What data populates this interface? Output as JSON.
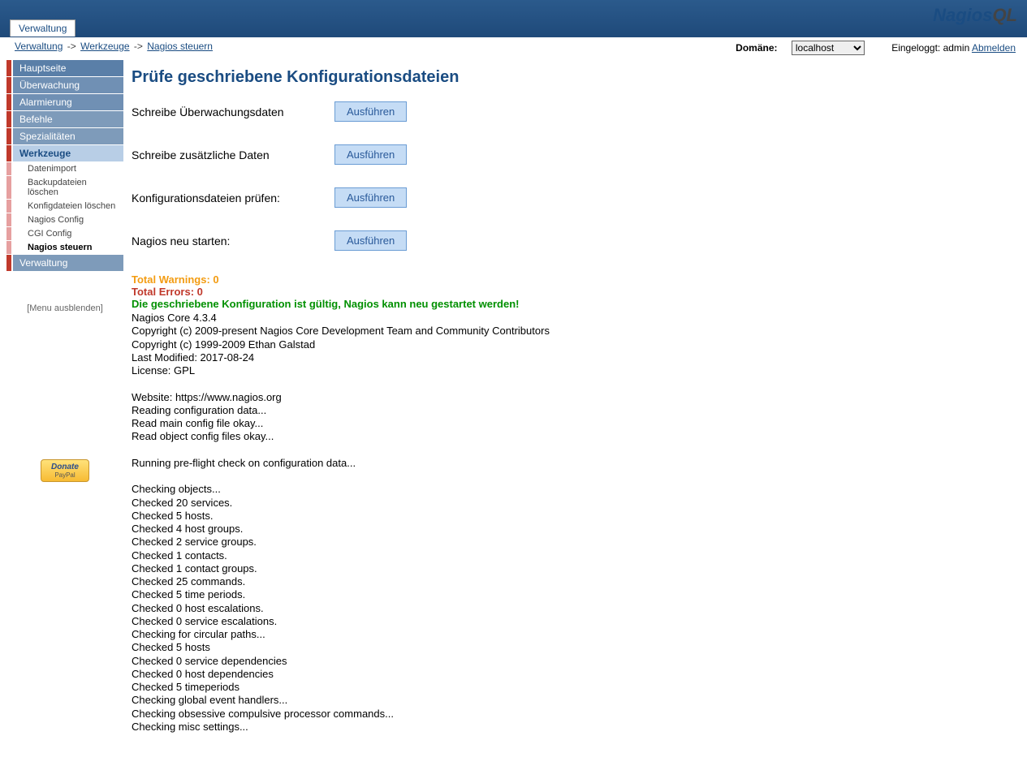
{
  "tab_label": "Verwaltung",
  "logo_text": "NagiosQL",
  "breadcrumb": {
    "part1": "Verwaltung",
    "sep": "->",
    "part2": "Werkzeuge",
    "part3": "Nagios steuern"
  },
  "domain": {
    "label": "Domäne:",
    "value": "localhost"
  },
  "login": {
    "prefix": "Eingeloggt: admin",
    "logout": "Abmelden"
  },
  "nav": {
    "main": "Hauptseite",
    "monitoring": "Überwachung",
    "alarming": "Alarmierung",
    "commands": "Befehle",
    "specials": "Spezialitäten",
    "tools": "Werkzeuge",
    "sub": {
      "import": "Datenimport",
      "delbackup": "Backupdateien löschen",
      "delconfig": "Konfigdateien löschen",
      "nagioscfg": "Nagios Config",
      "cgicfg": "CGI Config",
      "control": "Nagios steuern"
    },
    "admin": "Verwaltung",
    "hide": "[Menu ausblenden]",
    "donate": "Donate",
    "donate_sub": "PayPal"
  },
  "page_title": "Prüfe geschriebene Konfigurationsdateien",
  "actions": {
    "row1": {
      "label": "Schreibe Überwachungsdaten",
      "btn": "Ausführen"
    },
    "row2": {
      "label": "Schreibe zusätzliche Daten",
      "btn": "Ausführen"
    },
    "row3": {
      "label": "Konfigurationsdateien prüfen:",
      "btn": "Ausführen"
    },
    "row4": {
      "label": "Nagios neu starten:",
      "btn": "Ausführen"
    }
  },
  "result": {
    "warnings": "Total Warnings: 0",
    "errors": "Total Errors: 0",
    "success": "Die geschriebene Konfiguration ist gültig, Nagios kann neu gestartet werden!",
    "output": "Nagios Core 4.3.4\nCopyright (c) 2009-present Nagios Core Development Team and Community Contributors\nCopyright (c) 1999-2009 Ethan Galstad\nLast Modified: 2017-08-24\nLicense: GPL\n\nWebsite: https://www.nagios.org\nReading configuration data...\nRead main config file okay...\nRead object config files okay...\n\nRunning pre-flight check on configuration data...\n\nChecking objects...\nChecked 20 services.\nChecked 5 hosts.\nChecked 4 host groups.\nChecked 2 service groups.\nChecked 1 contacts.\nChecked 1 contact groups.\nChecked 25 commands.\nChecked 5 time periods.\nChecked 0 host escalations.\nChecked 0 service escalations.\nChecking for circular paths...\nChecked 5 hosts\nChecked 0 service dependencies\nChecked 0 host dependencies\nChecked 5 timeperiods\nChecking global event handlers...\nChecking obsessive compulsive processor commands...\nChecking misc settings..."
  }
}
